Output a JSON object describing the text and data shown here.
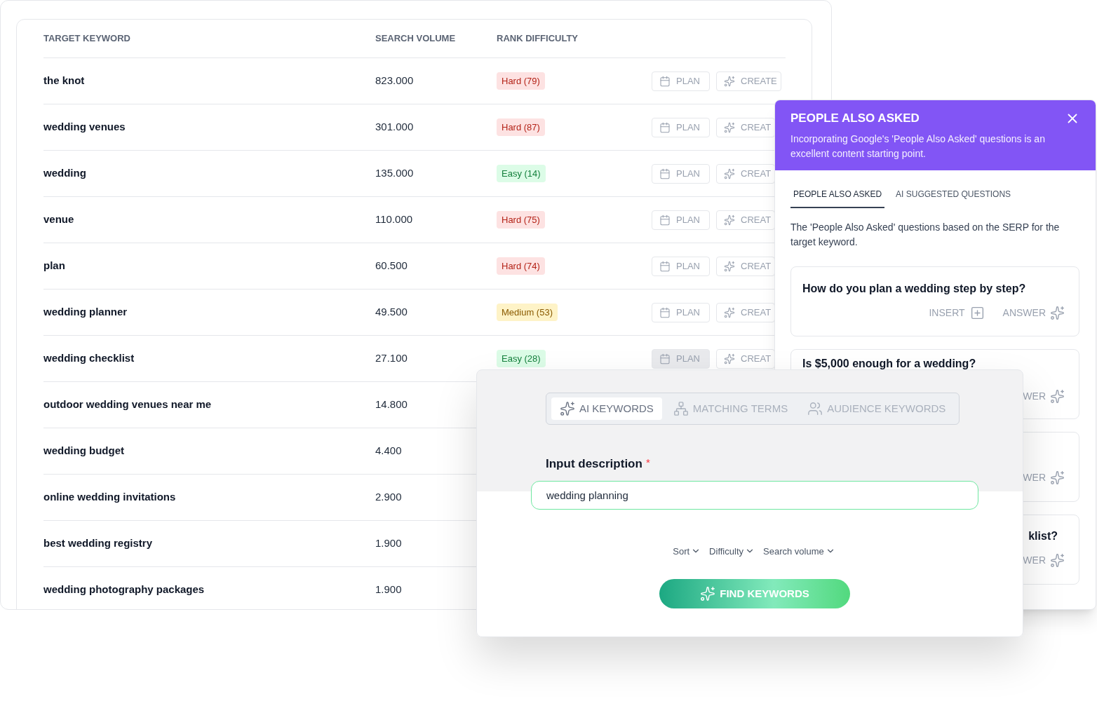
{
  "keywords_table": {
    "columns": [
      "TARGET KEYWORD",
      "SEARCH VOLUME",
      "RANK DIFFICULTY"
    ],
    "rows": [
      {
        "keyword": "the knot",
        "volume": "823.000",
        "difficulty": {
          "label": "Hard (79)",
          "kind": "hard"
        },
        "plan": {
          "label": "PLAN",
          "highlighted": false
        },
        "create": "CREATE"
      },
      {
        "keyword": "wedding venues",
        "volume": "301.000",
        "difficulty": {
          "label": "Hard (87)",
          "kind": "hard"
        },
        "plan": {
          "label": "PLAN",
          "highlighted": false
        },
        "create": "CREAT"
      },
      {
        "keyword": "wedding",
        "volume": "135.000",
        "difficulty": {
          "label": "Easy (14)",
          "kind": "easy"
        },
        "plan": {
          "label": "PLAN",
          "highlighted": false
        },
        "create": "CREAT"
      },
      {
        "keyword": "venue",
        "volume": "110.000",
        "difficulty": {
          "label": "Hard (75)",
          "kind": "hard"
        },
        "plan": {
          "label": "PLAN",
          "highlighted": false
        },
        "create": "CREAT"
      },
      {
        "keyword": "plan",
        "volume": "60.500",
        "difficulty": {
          "label": "Hard (74)",
          "kind": "hard"
        },
        "plan": {
          "label": "PLAN",
          "highlighted": false
        },
        "create": "CREAT"
      },
      {
        "keyword": "wedding planner",
        "volume": "49.500",
        "difficulty": {
          "label": "Medium (53)",
          "kind": "medium"
        },
        "plan": {
          "label": "PLAN",
          "highlighted": false
        },
        "create": "CREAT"
      },
      {
        "keyword": "wedding checklist",
        "volume": "27.100",
        "difficulty": {
          "label": "Easy (28)",
          "kind": "easy"
        },
        "plan": {
          "label": "PLAN",
          "highlighted": true
        },
        "create": "CREAT"
      },
      {
        "keyword": "outdoor wedding venues near me",
        "volume": "14.800"
      },
      {
        "keyword": "wedding budget",
        "volume": "4.400"
      },
      {
        "keyword": "online wedding invitations",
        "volume": "2.900"
      },
      {
        "keyword": "best wedding registry",
        "volume": "1.900"
      },
      {
        "keyword": "wedding photography packages",
        "volume": "1.900"
      }
    ]
  },
  "people_also_asked": {
    "title": "PEOPLE ALSO ASKED",
    "description": "Incorporating Google's 'People Also Asked' questions is an excellent content starting point.",
    "tabs": [
      {
        "label": "PEOPLE ALSO ASKED",
        "selected": true
      },
      {
        "label": "AI SUGGESTED QUESTIONS",
        "selected": false
      }
    ],
    "intro": "The 'People Also Asked' questions based on the SERP for the target keyword.",
    "questions": [
      {
        "kind": "full",
        "title": "How do you plan a wedding step by step?",
        "insert": "INSERT",
        "answer": "ANSWER"
      },
      {
        "kind": "peek",
        "title": "Is $5,000 enough for a wedding?",
        "answer": "WER"
      },
      {
        "kind": "tail",
        "answer": "WER"
      },
      {
        "kind": "tail",
        "title": "klist?",
        "answer": "WER"
      }
    ]
  },
  "keyword_finder": {
    "tabs": [
      {
        "label": "AI KEYWORDS",
        "selected": true
      },
      {
        "label": "MATCHING TERMS",
        "selected": false
      },
      {
        "label": "AUDIENCE KEYWORDS",
        "selected": false
      }
    ],
    "input": {
      "label": "Input description",
      "required_mark": "*",
      "value": "wedding planning"
    },
    "filters": [
      "Sort",
      "Difficulty",
      "Search volume"
    ],
    "button": "FIND KEYWORDS"
  }
}
